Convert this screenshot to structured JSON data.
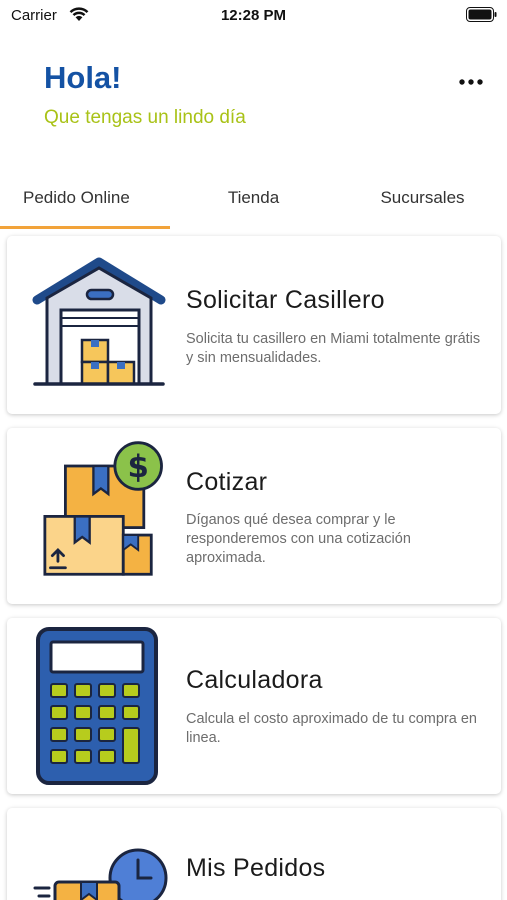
{
  "status_bar": {
    "carrier": "Carrier",
    "time": "12:28 PM"
  },
  "header": {
    "greeting": "Hola!",
    "subtitle": "Que tengas un lindo día"
  },
  "tabs": [
    {
      "label": "Pedido Online",
      "active": true
    },
    {
      "label": "Tienda",
      "active": false
    },
    {
      "label": "Sucursales",
      "active": false
    }
  ],
  "cards": [
    {
      "icon": "warehouse-icon",
      "title": "Solicitar Casillero",
      "description": "Solicita tu casillero en Miami totalmente grátis y sin mensualidades."
    },
    {
      "icon": "quote-boxes-dollar-icon",
      "title": "Cotizar",
      "description": "Díganos qué desea comprar y le responderemos con una cotización aproximada."
    },
    {
      "icon": "calculator-icon",
      "title": "Calculadora",
      "description": "Calcula el costo aproximado de tu compra en linea."
    },
    {
      "icon": "delivery-clock-icon",
      "title": "Mis Pedidos",
      "description": ""
    }
  ],
  "colors": {
    "brand_blue": "#1452a4",
    "accent_green": "#a9c217",
    "tab_indicator": "#f2a33a"
  }
}
